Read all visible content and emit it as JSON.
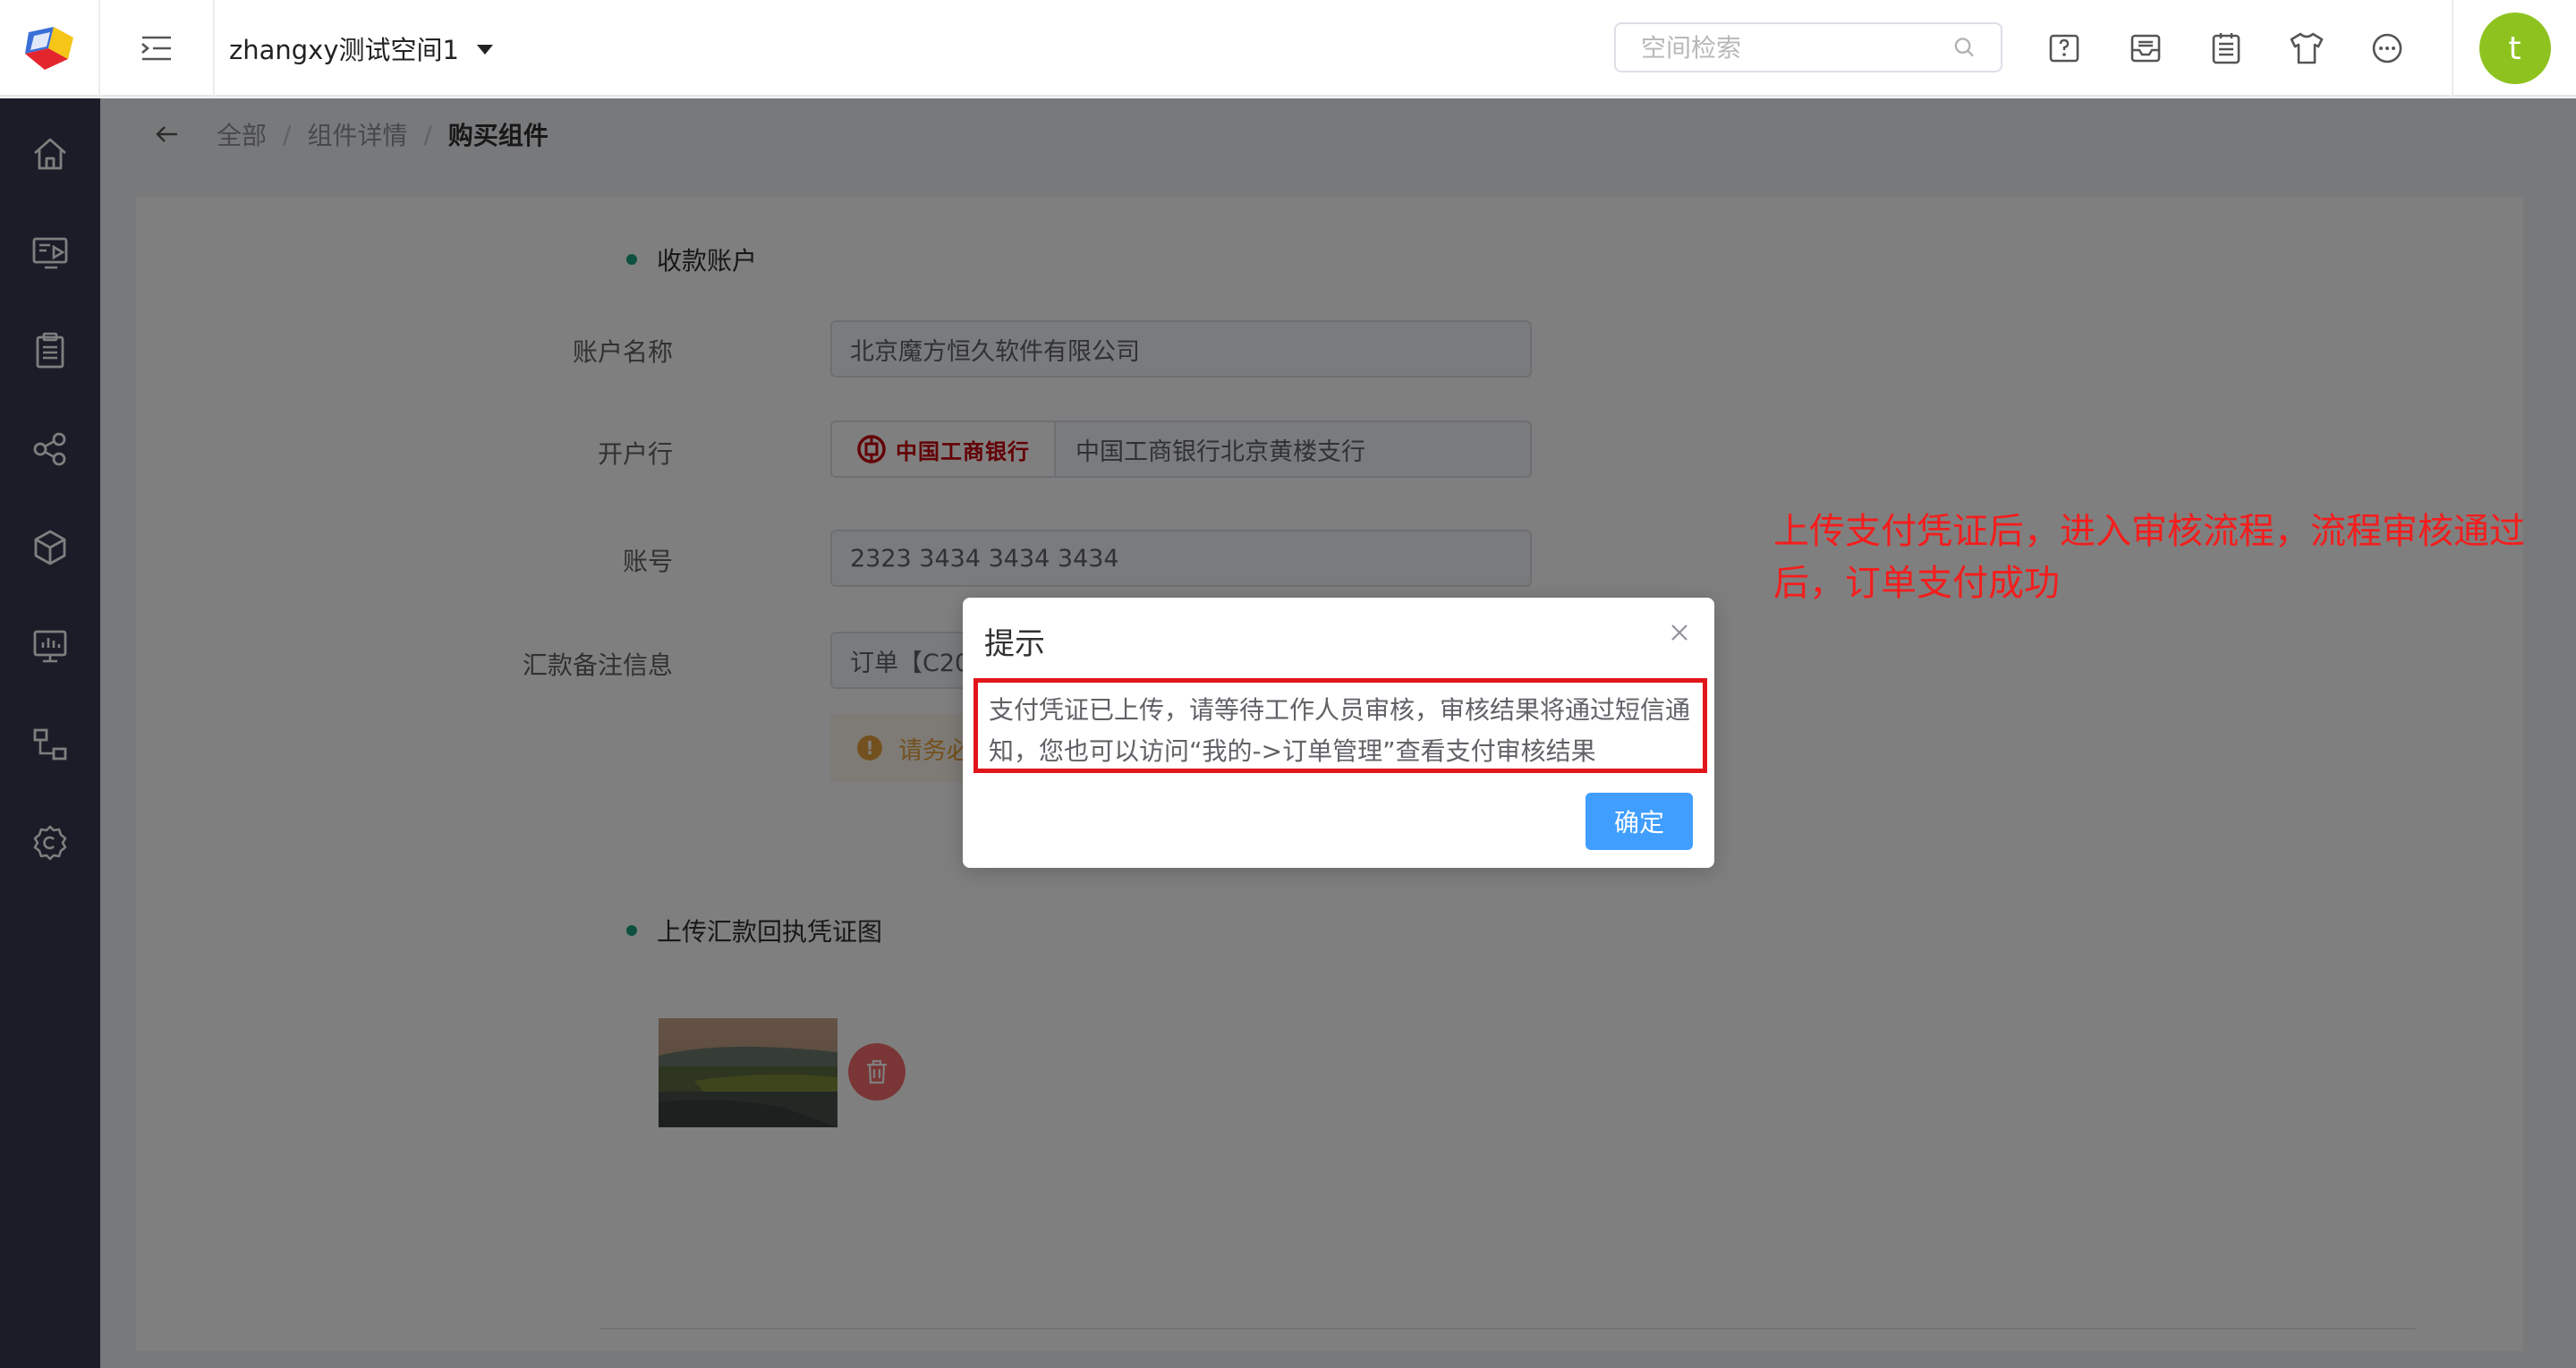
{
  "header": {
    "workspace_name": "zhangxy测试空间1",
    "search_placeholder": "空间检索",
    "avatar_letter": "t",
    "toolbar_icons": [
      "help-icon",
      "inbox-icon",
      "notes-icon",
      "theme-shirt-icon",
      "chat-icon"
    ]
  },
  "sidebar": {
    "items": [
      "home-icon",
      "screen-icon",
      "clipboard-icon",
      "share-nodes-icon",
      "cube-icon",
      "monitor-icon",
      "flow-icon",
      "settings-icon"
    ]
  },
  "breadcrumb": {
    "items": [
      "全部",
      "组件详情",
      "购买组件"
    ],
    "separator": "/"
  },
  "receiving_account": {
    "section_title": "收款账户",
    "account_name_label": "账户名称",
    "account_name_value": "北京魔方恒久软件有限公司",
    "bank_label": "开户行",
    "bank_logo_text": "中国工商银行",
    "bank_value": "中国工商银行北京黄楼支行",
    "account_no_label": "账号",
    "account_no_value": "2323 3434 3434 3434",
    "remark_label": "汇款备注信息",
    "remark_value": "订单【C20",
    "notice_text": "请务必"
  },
  "upload": {
    "section_title": "上传汇款回执凭证图"
  },
  "dialog": {
    "title": "提示",
    "message": "支付凭证已上传，请等待工作人员审核，审核结果将通过短信通知，您也可以访问“我的->订单管理”查看支付审核结果",
    "ok_label": "确定"
  },
  "annotation": {
    "text": "上传支付凭证后，进入审核流程，流程审核通过后，订单支付成功"
  },
  "colors": {
    "sidebar_bg": "#353a50",
    "primary": "#409eff",
    "success_dot": "#1aa17f",
    "danger": "#f56c6c",
    "annotation_red": "#f51d1d",
    "avatar_green": "#8ec31f"
  }
}
